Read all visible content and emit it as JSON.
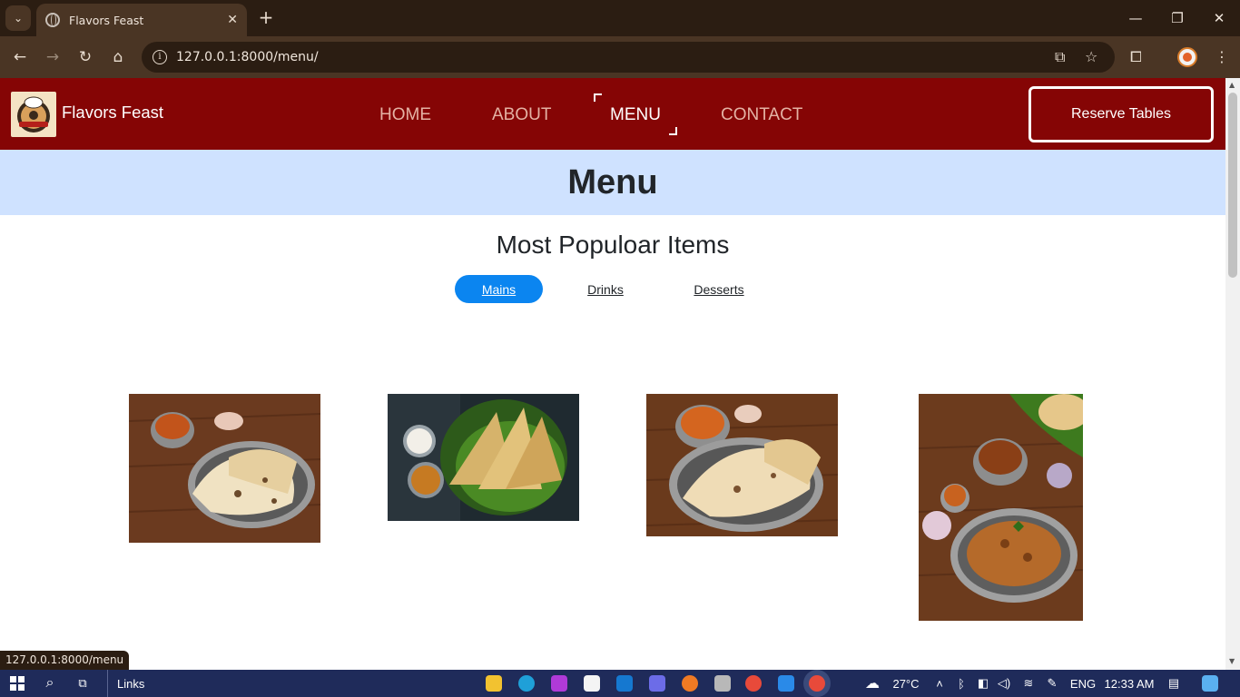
{
  "browser": {
    "tab_title": "Flavors Feast",
    "tab_close": "✕",
    "new_tab": "+",
    "url": "127.0.0.1:8000/menu/",
    "status_url": "127.0.0.1:8000/menu"
  },
  "site": {
    "brand": "Flavors Feast",
    "nav": [
      "HOME",
      "ABOUT",
      "MENU",
      "CONTACT"
    ],
    "active_nav": "MENU",
    "reserve_label": "Reserve Tables",
    "page_title": "Menu",
    "section_title": "Most Populoar Items",
    "categories": [
      "Mains",
      "Drinks",
      "Desserts"
    ],
    "active_category": "Mains",
    "colors": {
      "header": "#850505",
      "banner": "#cfe2ff",
      "active_pill": "#0b85f0"
    },
    "menu_items": [
      {
        "image": "naan-curry-bowl-image"
      },
      {
        "image": "dosa-banana-leaf-image"
      },
      {
        "image": "naan-chicken-curry-image"
      },
      {
        "image": "biryani-feast-image"
      }
    ]
  },
  "taskbar": {
    "links_label": "Links",
    "weather": "27°C",
    "language": "ENG",
    "time": "12:33 AM"
  }
}
